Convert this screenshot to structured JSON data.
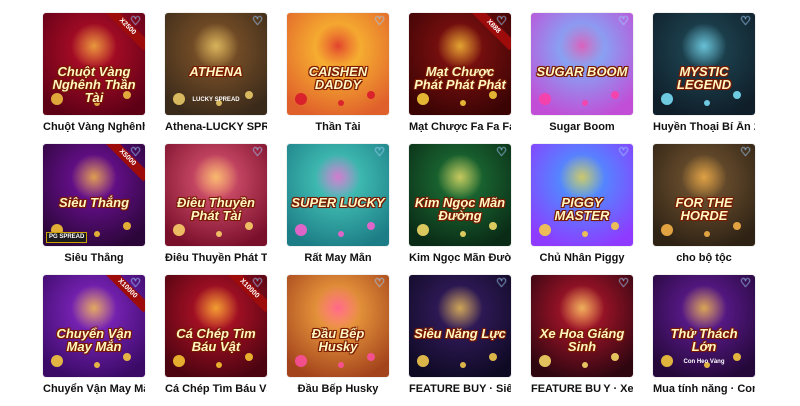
{
  "games": [
    {
      "caption": "Chuột Vàng Nghênh",
      "art_title": "Chuột Vàng Nghênh Thần Tài",
      "multiplier": "X2500",
      "bg": [
        "#c0102b",
        "#5d0016"
      ],
      "accent": "#f5c542"
    },
    {
      "caption": "Athena-LUCKY SPR",
      "art_title": "ATHENA",
      "art_sub": "LUCKY SPREAD",
      "bg": [
        "#8a5a2b",
        "#3a2a1a"
      ],
      "accent": "#f2d16b"
    },
    {
      "caption": "Thần Tài",
      "art_title": "CAISHEN DADDY",
      "bg": [
        "#ffcf33",
        "#e0602b"
      ],
      "accent": "#d8152c"
    },
    {
      "caption": "Mạt Chược Fa Fa Fa",
      "art_title": "Mạt Chược Phát Phát Phát",
      "multiplier": "X888",
      "bg": [
        "#8e1313",
        "#3b0404"
      ],
      "accent": "#ffd43b"
    },
    {
      "caption": "Sugar Boom",
      "art_title": "SUGAR BOOM",
      "bg": [
        "#6fc5ff",
        "#c24dd6"
      ],
      "accent": "#ff3fa6"
    },
    {
      "caption": "Huyền Thoại Bí Ẩn 2",
      "art_title": "MYSTIC LEGEND",
      "bg": [
        "#214c5a",
        "#0f1e29"
      ],
      "accent": "#7fe7ff"
    },
    {
      "caption": "Siêu Thắng",
      "art_title": "Siêu Thắng",
      "multiplier": "X5000",
      "badge": "PG SPREAD",
      "bg": [
        "#7a12a8",
        "#2b0638"
      ],
      "accent": "#ffcc33"
    },
    {
      "caption": "Điêu Thuyền Phát T",
      "art_title": "Điêu Thuyền Phát Tài",
      "bg": [
        "#e35d7a",
        "#7a0f2b"
      ],
      "accent": "#ffd86b"
    },
    {
      "caption": "Rất May Mắn",
      "art_title": "SUPER LUCKY",
      "bg": [
        "#4cd3c2",
        "#1d7d86"
      ],
      "accent": "#ff5fd2"
    },
    {
      "caption": "Kim Ngọc Mãn Đườ",
      "art_title": "Kim Ngọc Mãn Đường",
      "bg": [
        "#1f7a3a",
        "#0a2b16"
      ],
      "accent": "#ffe36b"
    },
    {
      "caption": "Chủ Nhân Piggy",
      "art_title": "PIGGY MASTER",
      "bg": [
        "#3aa7ff",
        "#8e3bff"
      ],
      "accent": "#ffd23b"
    },
    {
      "caption": "cho bộ tộc",
      "art_title": "FOR THE HORDE",
      "bg": [
        "#7a5a35",
        "#2e2214"
      ],
      "accent": "#ffb84a"
    },
    {
      "caption": "Chuyển Vận May Mắ",
      "art_title": "Chuyển Vận May Mắn",
      "multiplier": "X10000",
      "bg": [
        "#8d2bd0",
        "#3a0a66"
      ],
      "accent": "#ffd23b"
    },
    {
      "caption": "Cá Chép Tìm Báu Vậ",
      "art_title": "Cá Chép Tìm Báu Vật",
      "multiplier": "X10000",
      "bg": [
        "#c5142c",
        "#4b0410"
      ],
      "accent": "#ffcc33"
    },
    {
      "caption": "Đầu Bếp Husky",
      "art_title": "Đầu Bếp Husky",
      "bg": [
        "#ffb347",
        "#a3431c"
      ],
      "accent": "#ff4fa0"
    },
    {
      "caption": "FEATURE BUY · Siê",
      "art_title": "Siêu Năng Lực",
      "bg": [
        "#3b1f6a",
        "#0f0a24"
      ],
      "accent": "#ffd34f"
    },
    {
      "caption": "FEATURE BU Y · Xe",
      "art_title": "Xe Hoa Giáng Sinh",
      "bg": [
        "#c21830",
        "#2e0610"
      ],
      "accent": "#ffe36b"
    },
    {
      "caption": "Mua tính năng · Con",
      "art_title": "Thử Thách Lớn",
      "art_sub": "Con Heo Vàng",
      "bg": [
        "#6a1fa3",
        "#240839"
      ],
      "accent": "#ffd23b"
    }
  ]
}
